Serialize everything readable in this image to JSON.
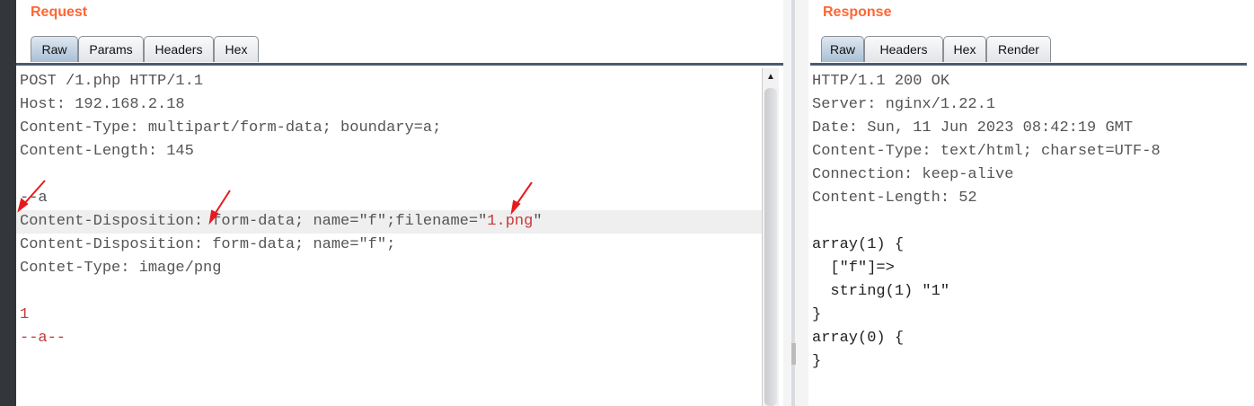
{
  "request": {
    "title": "Request",
    "tabs": [
      {
        "label": "Raw",
        "active": true
      },
      {
        "label": "Params"
      },
      {
        "label": "Headers"
      },
      {
        "label": "Hex"
      }
    ],
    "lines": [
      "POST /1.php HTTP/1.1",
      "Host: 192.168.2.18",
      "Content-Type: multipart/form-data; boundary=a;",
      "Content-Length: 145",
      "",
      "--a",
      "Content-Disposition: form-data; name=\"f\";filename=\"",
      "Content-Disposition: form-data; name=\"f\";",
      "Contet-Type: image/png",
      "",
      "1",
      "--a--"
    ],
    "highlight_value": "1.png",
    "highlight_close": "\""
  },
  "response": {
    "title": "Response",
    "tabs": [
      {
        "label": "Raw",
        "active": true
      },
      {
        "label": "Headers"
      },
      {
        "label": "Hex"
      },
      {
        "label": "Render"
      }
    ],
    "lines": [
      "HTTP/1.1 200 OK",
      "Server: nginx/1.22.1",
      "Date: Sun, 11 Jun 2023 08:42:19 GMT",
      "Content-Type: text/html; charset=UTF-8",
      "Connection: keep-alive",
      "Content-Length: 52",
      "",
      "array(1) {",
      "  [\"f\"]=>",
      "  string(1) \"1\"",
      "}",
      "array(0) {",
      "}"
    ]
  },
  "colors": {
    "title": "#ff6633",
    "annotation_arrow": "#e8191d",
    "body_red": "#c8373b"
  }
}
